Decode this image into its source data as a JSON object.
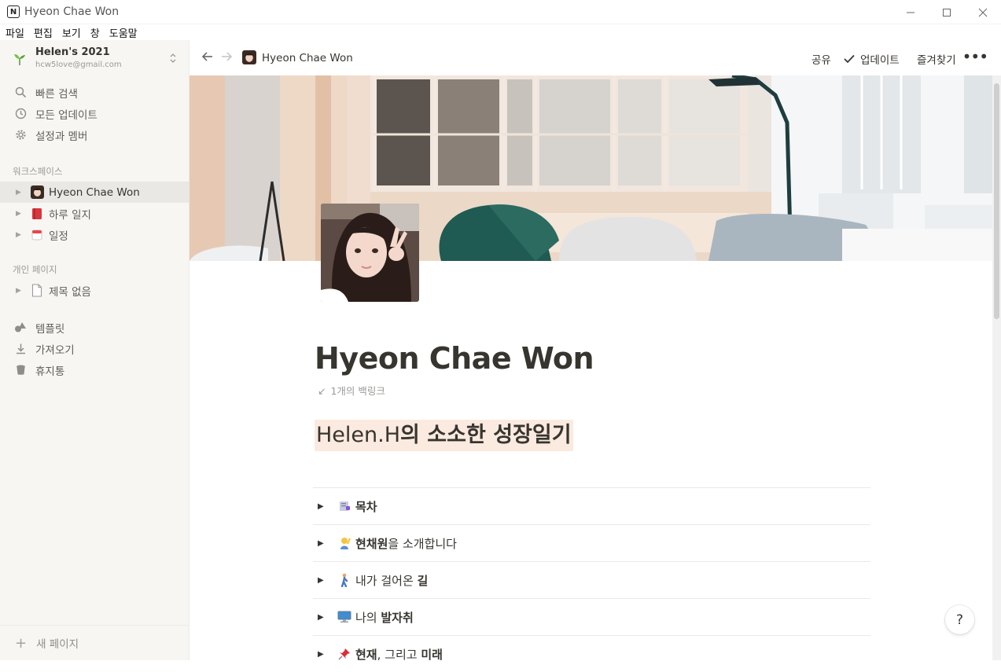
{
  "window": {
    "title": "Hyeon Chae Won",
    "app_icon": "N"
  },
  "menubar": {
    "items": [
      "파일",
      "편집",
      "보기",
      "창",
      "도움말"
    ]
  },
  "sidebar": {
    "workspace_name": "Helen's 2021",
    "workspace_email": "hcw5love@gmail.com",
    "quick": [
      {
        "icon": "search-icon",
        "label": "빠른 검색"
      },
      {
        "icon": "clock-icon",
        "label": "모든 업데이트"
      },
      {
        "icon": "gear-icon",
        "label": "설정과 멤버"
      }
    ],
    "workspace_header": "워크스페이스",
    "workspace_pages": [
      {
        "icon": "avatar",
        "label": "Hyeon Chae Won"
      },
      {
        "icon": "red-book-icon",
        "label": "하루 일지"
      },
      {
        "icon": "calendar-icon",
        "label": "일정"
      }
    ],
    "private_header": "개인 페이지",
    "private_pages": [
      {
        "icon": "page-icon",
        "label": "제목 없음"
      }
    ],
    "bottom": [
      {
        "icon": "shapes-icon",
        "label": "템플릿"
      },
      {
        "icon": "download-icon",
        "label": "가져오기"
      },
      {
        "icon": "trash-icon",
        "label": "휴지통"
      }
    ],
    "new_page": "새 페이지"
  },
  "topbar": {
    "breadcrumb": "Hyeon Chae Won",
    "share": "공유",
    "updates": "업데이트",
    "favorite": "즐겨찾기"
  },
  "page": {
    "title": "Hyeon Chae Won",
    "backlinks": "1개의 백링크",
    "heading_prefix": "Helen.H",
    "heading_rest": "의 소소한 성장일기",
    "toggles": [
      {
        "emoji": "bookmark-tabs",
        "parts": [
          {
            "t": "목차",
            "b": true
          }
        ]
      },
      {
        "emoji": "person-raising-hand",
        "parts": [
          {
            "t": "현채원",
            "b": true
          },
          {
            "t": "을 소개합니다",
            "b": false
          }
        ]
      },
      {
        "emoji": "person-walking",
        "parts": [
          {
            "t": "내가 걸어온 ",
            "b": false
          },
          {
            "t": "길",
            "b": true
          }
        ]
      },
      {
        "emoji": "desktop-computer",
        "parts": [
          {
            "t": "나의 ",
            "b": false
          },
          {
            "t": "발자취",
            "b": true
          }
        ]
      },
      {
        "emoji": "pushpin",
        "parts": [
          {
            "t": "현재",
            "b": true
          },
          {
            "t": ", 그리고 ",
            "b": false
          },
          {
            "t": "미래",
            "b": true
          }
        ]
      }
    ]
  },
  "help": "?"
}
